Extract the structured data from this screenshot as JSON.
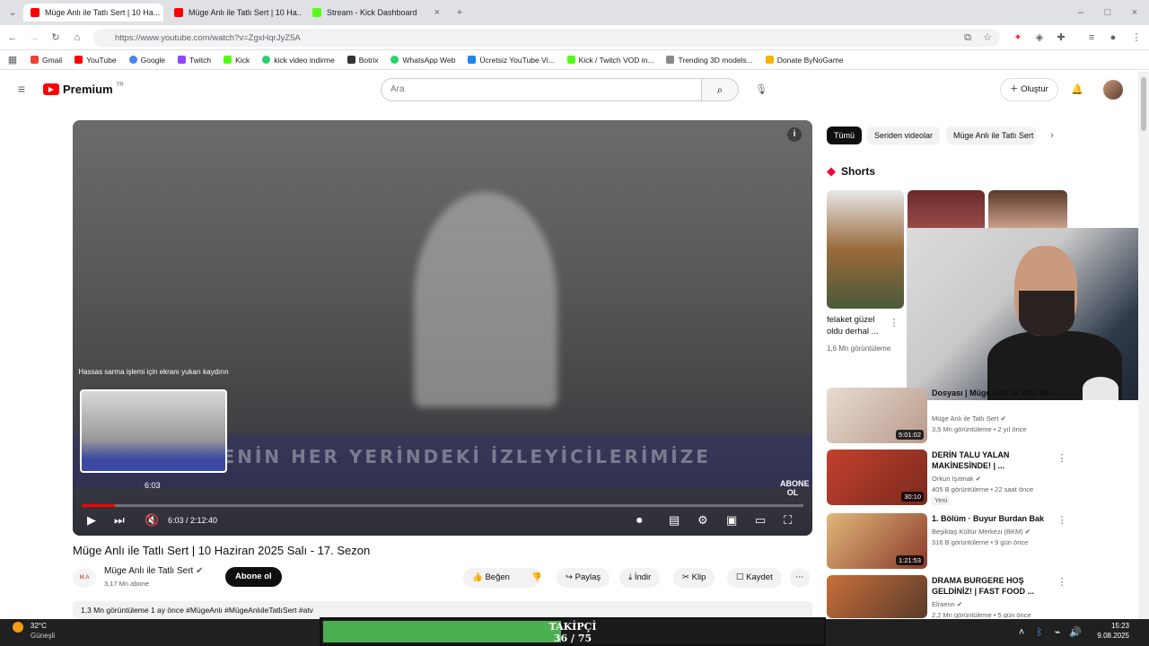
{
  "browser": {
    "tabs": [
      {
        "label": "Müge Anlı ile Tatlı Sert | 10 Ha...",
        "active": true,
        "color": "#ff0000"
      },
      {
        "label": "Müge Anlı ile Tatlı Sert | 10 Ha...",
        "active": false,
        "color": "#ff0000"
      },
      {
        "label": "Stream - Kick Dashboard",
        "active": false,
        "color": "#53fc18"
      }
    ],
    "url": "https://www.youtube.com/watch?v=ZgxHqrJyZ5A",
    "bookmarks": [
      {
        "label": "Gmail",
        "color": "#ea4335"
      },
      {
        "label": "YouTube",
        "color": "#ff0000"
      },
      {
        "label": "Google",
        "color": "#4285f4"
      },
      {
        "label": "Twitch",
        "color": "#9146ff"
      },
      {
        "label": "Kick",
        "color": "#53fc18"
      },
      {
        "label": "kick video indirme",
        "color": "#2ecc71"
      },
      {
        "label": "Botrix",
        "color": "#333333"
      },
      {
        "label": "WhatsApp Web",
        "color": "#25d366"
      },
      {
        "label": "Ücretsiz YouTube Vi...",
        "color": "#1e88e5"
      },
      {
        "label": "Kick / Twitch VOD in...",
        "color": "#53fc18"
      },
      {
        "label": "Trending 3D models...",
        "color": "#888888"
      },
      {
        "label": "Donate ByNoGame",
        "color": "#f4b400"
      }
    ]
  },
  "youtube": {
    "logo": "Premium",
    "logo_sup": "TR",
    "search_placeholder": "Ara",
    "create_label": "Oluştur",
    "video": {
      "hint": "Hassas sarma işlemi için ekranı yukarı kaydırın",
      "preview_time": "6:03",
      "time": "6:03 / 2:12:40",
      "progress": 0.046,
      "caption": "ÜLKENİN HER YERİNDEKİ İZLEYİCİLERİMİZE",
      "watermark": "ABONE OL"
    },
    "title": "Müge Anlı ile Tatlı Sert | 10 Haziran 2025 Salı - 17. Sezon",
    "channel": {
      "name": "Müge Anlı ile Tatlı Sert",
      "subs": "3,17 Mn abone",
      "subscribe": "Abone ol"
    },
    "actions": {
      "like": "Beğen",
      "share": "Paylaş",
      "download": "İndir",
      "clip": "Klip",
      "save": "Kaydet"
    },
    "description_meta": "1,3 Mn görüntüleme  1 ay önce  #MügeAnlı #MügeAnlıileTatlıSert #atv",
    "chips": [
      "Tümü",
      "Seriden videolar",
      "Müge Anlı ile Tatlı Sert"
    ],
    "shorts_label": "Shorts",
    "short": {
      "title": "felaket güzel oldu derhal ...",
      "views": "1,6 Mn görüntüleme"
    },
    "recommendations": [
      {
        "title": "Dosyası | Müge Anlı ile Tatlı Se...",
        "channel": "Müge Anlı ile Tatlı Sert",
        "meta": "3,5 Mn görüntüleme • 2 yıl önce",
        "duration": "5:01:02",
        "color": "#d9c9c0"
      },
      {
        "title": "DERİN TALU YALAN MAKİNESİNDE! | ...",
        "channel": "Orkun Işıtmak",
        "meta": "405 B görüntüleme • 22 saat önce",
        "badge": "Yeni",
        "duration": "30:10",
        "color": "#b2402e"
      },
      {
        "title": "1. Bölüm · Buyur Burdan Bak",
        "channel": "Beşiktaş Kültür Merkezi (BKM)",
        "meta": "316 B görüntüleme • 9 gün önce",
        "duration": "1:21:53",
        "color": "#c9a56a"
      },
      {
        "title": "DRAMA BURGERE HOŞ GELDİNİZ! | FAST FOOD ...",
        "channel": "Elraenn",
        "meta": "2,2 Mn görüntüleme • 5 gün önce",
        "duration": "",
        "color": "#8a5a3a"
      }
    ]
  },
  "taskbar": {
    "weather_temp": "32°C",
    "weather_desc": "Güneşli",
    "clock_time": "15:23",
    "clock_date": "9.08.2025"
  },
  "overlay": {
    "label": "TAKİPÇİ",
    "count": "36 / 75",
    "progress": 0.48
  }
}
